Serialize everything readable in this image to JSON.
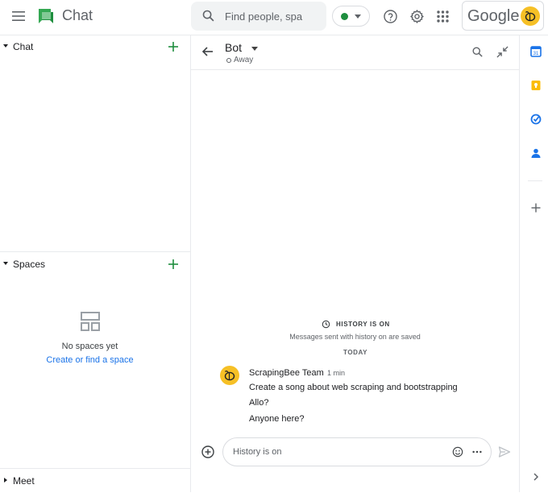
{
  "header": {
    "app_title": "Chat",
    "search_placeholder": "Find people, spa",
    "status": "Active",
    "status_color": "#1e8e3e",
    "account_brand": "Google"
  },
  "sidebar": {
    "chat_section": "Chat",
    "spaces_section": "Spaces",
    "empty_title": "No spaces yet",
    "empty_link": "Create or find a space",
    "meet_section": "Meet"
  },
  "conversation": {
    "name": "Bot",
    "presence": "Away",
    "history_label": "HISTORY IS ON",
    "history_sub": "Messages sent with history on are saved",
    "day_divider": "TODAY",
    "sender": "ScrapingBee Team",
    "time": "1 min",
    "messages": [
      "Create a song about web scraping and bootstrapping",
      "Allo?",
      "Anyone here?"
    ],
    "composer_placeholder": "History is on"
  },
  "side_apps": [
    "calendar-icon",
    "keep-icon",
    "tasks-icon",
    "contacts-icon",
    "add-app-icon"
  ],
  "colors": {
    "accent_blue": "#1a73e8",
    "avatar_yellow": "#f6c026",
    "plus_green": "#1e8e3e"
  }
}
